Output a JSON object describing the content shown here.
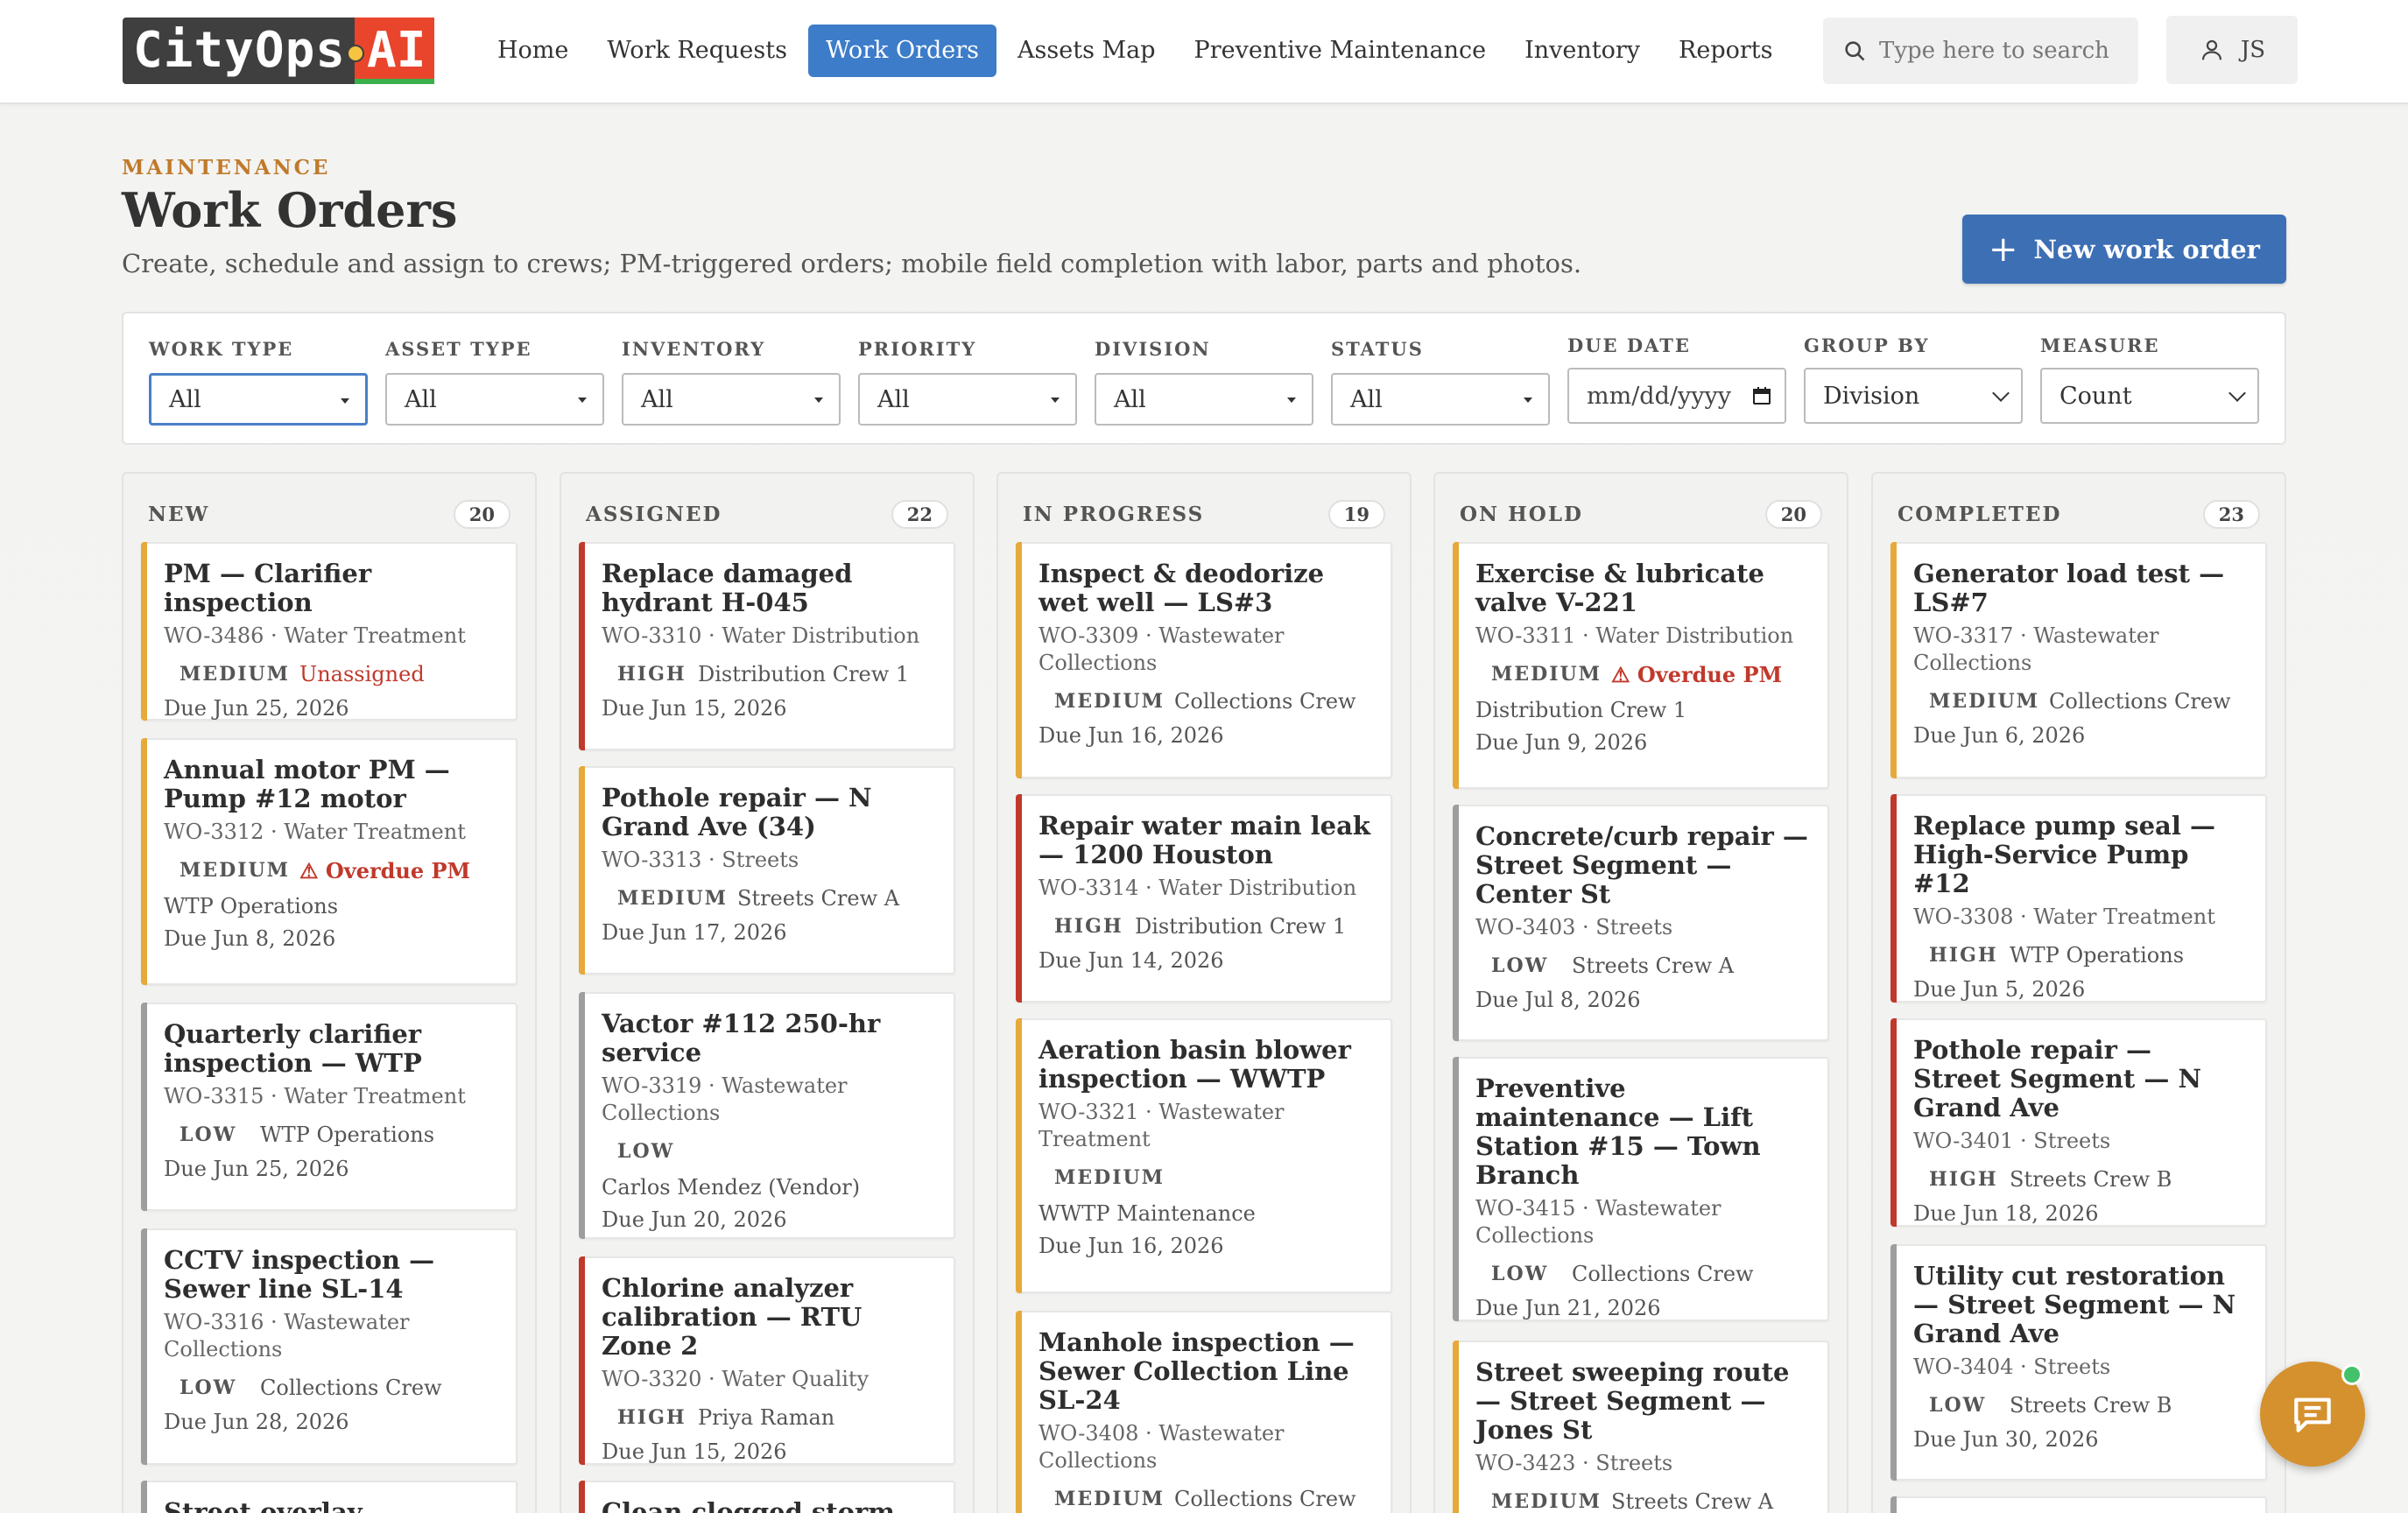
{
  "app": {
    "logo_main": "CityOps",
    "logo_ai": "AI"
  },
  "nav": {
    "items": [
      {
        "label": "Home"
      },
      {
        "label": "Work Requests"
      },
      {
        "label": "Work Orders",
        "active": true
      },
      {
        "label": "Assets Map"
      },
      {
        "label": "Preventive Maintenance"
      },
      {
        "label": "Inventory"
      },
      {
        "label": "Reports"
      }
    ]
  },
  "search": {
    "placeholder": "Type here to search"
  },
  "user": {
    "initials": "JS"
  },
  "header": {
    "eyebrow": "MAINTENANCE",
    "title": "Work Orders",
    "subtitle": "Create, schedule and assign to crews; PM-triggered orders; mobile field completion with labor, parts and photos.",
    "new_button": "New work order"
  },
  "filters": {
    "work_type": {
      "label": "WORK TYPE",
      "value": "All"
    },
    "asset_type": {
      "label": "ASSET TYPE",
      "value": "All"
    },
    "inventory": {
      "label": "INVENTORY",
      "value": "All"
    },
    "priority": {
      "label": "PRIORITY",
      "value": "All"
    },
    "division": {
      "label": "DIVISION",
      "value": "All"
    },
    "status": {
      "label": "STATUS",
      "value": "All"
    },
    "due_date": {
      "label": "DUE DATE",
      "placeholder": "mm/dd/yyyy"
    },
    "group_by": {
      "label": "GROUP BY",
      "value": "Division"
    },
    "measure": {
      "label": "MEASURE",
      "value": "Count"
    }
  },
  "columns": [
    {
      "title": "NEW",
      "count": "20",
      "cards": [
        {
          "title": "PM — Clarifier inspection",
          "meta": "WO-3486 · Water Treatment",
          "priority": "MEDIUM",
          "assignee": "Unassigned",
          "due": "Due Jun 25, 2026"
        },
        {
          "title": "Annual motor PM — Pump #12 motor",
          "meta": "WO-3312 · Water Treatment",
          "priority": "MEDIUM",
          "flag": "⚠ Overdue PM",
          "crew": "WTP Operations",
          "due": "Due Jun 8, 2026"
        },
        {
          "title": "Quarterly clarifier inspection — WTP",
          "meta": "WO-3315 · Water Treatment",
          "priority": "LOW",
          "assignee": "WTP Operations",
          "due": "Due Jun 25, 2026"
        },
        {
          "title": "CCTV inspection — Sewer line SL-14",
          "meta": "WO-3316 · Wastewater Collections",
          "priority": "LOW",
          "assignee": "Collections Crew",
          "due": "Due Jun 28, 2026"
        },
        {
          "title": "Street overlay assessment",
          "meta": "",
          "priority": "",
          "assignee": "",
          "due": ""
        }
      ]
    },
    {
      "title": "ASSIGNED",
      "count": "22",
      "cards": [
        {
          "title": "Replace damaged hydrant H-045",
          "meta": "WO-3310 · Water Distribution",
          "priority": "HIGH",
          "assignee": "Distribution Crew 1",
          "due": "Due Jun 15, 2026"
        },
        {
          "title": "Pothole repair — N Grand Ave (34)",
          "meta": "WO-3313 · Streets",
          "priority": "MEDIUM",
          "assignee": "Streets Crew A",
          "due": "Due Jun 17, 2026"
        },
        {
          "title": "Vactor #112 250-hr service",
          "meta": "WO-3319 · Wastewater Collections",
          "priority": "LOW",
          "crew": "Carlos Mendez (Vendor)",
          "due": "Due Jun 20, 2026"
        },
        {
          "title": "Chlorine analyzer calibration — RTU Zone 2",
          "meta": "WO-3320 · Water Quality",
          "priority": "HIGH",
          "assignee": "Priya Raman",
          "due": "Due Jun 15, 2026"
        },
        {
          "title": "Clean clogged storm inlet",
          "meta": "",
          "priority": "",
          "assignee": "",
          "due": ""
        }
      ]
    },
    {
      "title": "IN PROGRESS",
      "count": "19",
      "cards": [
        {
          "title": "Inspect & deodorize wet well — LS#3",
          "meta": "WO-3309 · Wastewater Collections",
          "priority": "MEDIUM",
          "assignee": "Collections Crew",
          "due": "Due Jun 16, 2026"
        },
        {
          "title": "Repair water main leak — 1200 Houston",
          "meta": "WO-3314 · Water Distribution",
          "priority": "HIGH",
          "assignee": "Distribution Crew 1",
          "due": "Due Jun 14, 2026"
        },
        {
          "title": "Aeration basin blower inspection — WWTP",
          "meta": "WO-3321 · Wastewater Treatment",
          "priority": "MEDIUM",
          "crew": "WWTP Maintenance",
          "due": "Due Jun 16, 2026"
        },
        {
          "title": "Manhole inspection — Sewer Collection Line SL-24",
          "meta": "WO-3408 · Wastewater Collections",
          "priority": "MEDIUM",
          "assignee": "Collections Crew",
          "due": ""
        }
      ]
    },
    {
      "title": "ON HOLD",
      "count": "20",
      "cards": [
        {
          "title": "Exercise & lubricate valve V-221",
          "meta": "WO-3311 · Water Distribution",
          "priority": "MEDIUM",
          "flag": "⚠ Overdue PM",
          "crew": "Distribution Crew 1",
          "due": "Due Jun 9, 2026"
        },
        {
          "title": "Concrete/curb repair — Street Segment — Center St",
          "meta": "WO-3403 · Streets",
          "priority": "LOW",
          "assignee": "Streets Crew A",
          "due": "Due Jul 8, 2026"
        },
        {
          "title": "Preventive maintenance — Lift Station #15 — Town Branch",
          "meta": "WO-3415 · Wastewater Collections",
          "priority": "LOW",
          "assignee": "Collections Crew",
          "due": "Due Jun 21, 2026"
        },
        {
          "title": "Street sweeping route — Street Segment — Jones St",
          "meta": "WO-3423 · Streets",
          "priority": "MEDIUM",
          "assignee": "Streets Crew A",
          "due": ""
        }
      ]
    },
    {
      "title": "COMPLETED",
      "count": "23",
      "cards": [
        {
          "title": "Generator load test — LS#7",
          "meta": "WO-3317 · Wastewater Collections",
          "priority": "MEDIUM",
          "assignee": "Collections Crew",
          "due": "Due Jun 6, 2026"
        },
        {
          "title": "Replace pump seal — High-Service Pump #12",
          "meta": "WO-3308 · Water Treatment",
          "priority": "HIGH",
          "assignee": "WTP Operations",
          "due": "Due Jun 5, 2026"
        },
        {
          "title": "Pothole repair — Street Segment — N Grand Ave",
          "meta": "WO-3401 · Streets",
          "priority": "HIGH",
          "assignee": "Streets Crew B",
          "due": "Due Jun 18, 2026"
        },
        {
          "title": "Utility cut restoration — Street Segment — N Grand Ave",
          "meta": "WO-3404 · Streets",
          "priority": "LOW",
          "assignee": "Streets Crew B",
          "due": "Due Jun 30, 2026"
        }
      ]
    }
  ],
  "colors": {
    "high": "#c0392b",
    "medium": "#e6a93a",
    "low": "#9e9e9e",
    "primary": "#3d6fb5",
    "accent": "#c07a2b"
  }
}
